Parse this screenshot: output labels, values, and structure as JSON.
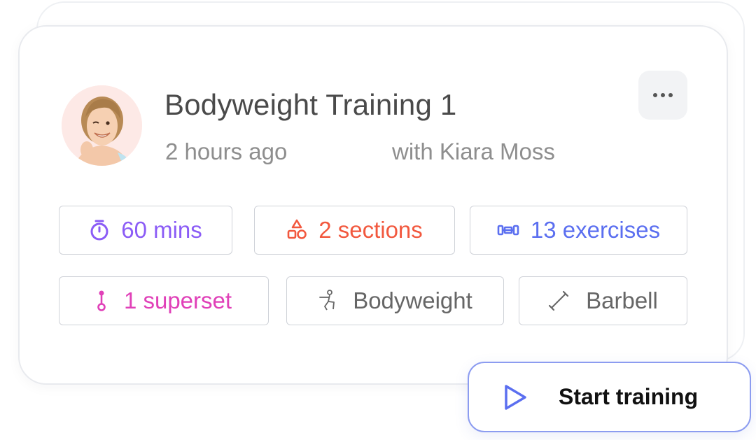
{
  "card": {
    "title": "Bodyweight Training 1",
    "time_ago": "2 hours ago",
    "coach": "with Kiara Moss",
    "more_icon": "more-horizontal-icon"
  },
  "chips": [
    {
      "label": "60 mins",
      "icon": "stopwatch-icon",
      "color": "#8b5cf6"
    },
    {
      "label": "2 sections",
      "icon": "shapes-icon",
      "color": "#f2583e"
    },
    {
      "label": "13 exercises",
      "icon": "dumbbell-icon",
      "color": "#5b6ff0"
    },
    {
      "label": "1 superset",
      "icon": "superset-icon",
      "color": "#e040b8"
    },
    {
      "label": "Bodyweight",
      "icon": "squat-figure-icon",
      "color": "#666666"
    },
    {
      "label": "Barbell",
      "icon": "barbell-icon",
      "color": "#666666"
    }
  ],
  "start_button": {
    "label": "Start training",
    "icon": "play-icon",
    "accent": "#5b6ff0"
  }
}
